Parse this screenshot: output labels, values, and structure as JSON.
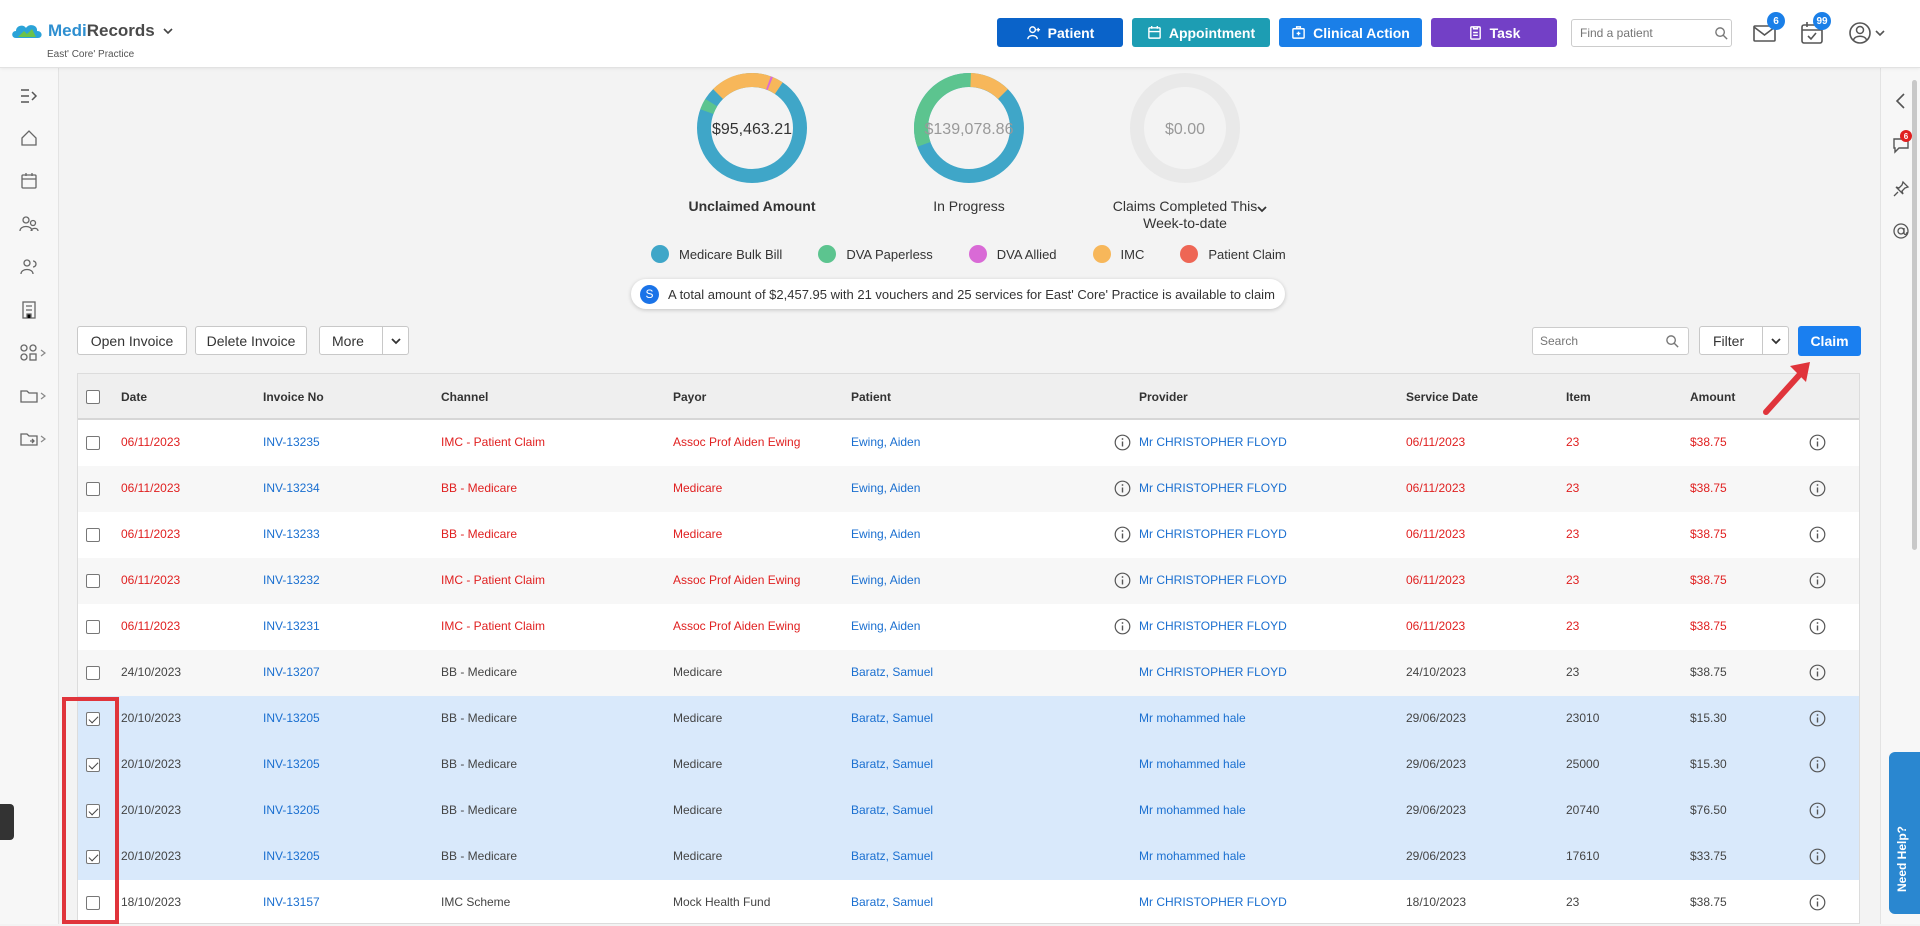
{
  "app": {
    "brand_part1": "Medi",
    "brand_part2": "Records",
    "practice": "East' Core' Practice"
  },
  "header": {
    "buttons": [
      {
        "label": "Patient",
        "color": "#0a63c9"
      },
      {
        "label": "Appointment",
        "color": "#1d9db3"
      },
      {
        "label": "Clinical Action",
        "color": "#1a7fe8"
      },
      {
        "label": "Task",
        "color": "#7340c6"
      }
    ],
    "find_placeholder": "Find a patient",
    "mail_count": "6",
    "tasks_count": "99"
  },
  "rightnav": {
    "chat_count": "6",
    "need_help": "Need Help?"
  },
  "summary": {
    "unclaimed": {
      "value": "$95,463.21",
      "label": "Unclaimed Amount"
    },
    "in_progress": {
      "value": "$139,078.86",
      "label": "In Progress"
    },
    "completed": {
      "value": "$0.00",
      "label_line1": "Claims Completed This",
      "label_line2": "Week-to-date"
    }
  },
  "legend": [
    {
      "label": "Medicare Bulk Bill",
      "color": "#3fa6c8"
    },
    {
      "label": "DVA Paperless",
      "color": "#5cc48f"
    },
    {
      "label": "DVA Allied",
      "color": "#d96ad6"
    },
    {
      "label": "IMC",
      "color": "#f7b75a"
    },
    {
      "label": "Patient Claim",
      "color": "#ee6655"
    }
  ],
  "info": {
    "icon_letter": "S",
    "message": "A total amount of $2,457.95 with 21 vouchers and 25 services for East' Core' Practice is available to claim"
  },
  "actions": {
    "open_invoice": "Open Invoice",
    "delete_invoice": "Delete Invoice",
    "more": "More",
    "search_placeholder": "Search",
    "filter": "Filter",
    "claim": "Claim"
  },
  "table": {
    "columns": [
      "Date",
      "Invoice No",
      "Channel",
      "Payor",
      "Patient",
      "Provider",
      "Service Date",
      "Item",
      "Amount"
    ],
    "rows": [
      {
        "date": "06/11/2023",
        "invoice": "INV-13235",
        "channel": "IMC - Patient Claim",
        "payor": "Assoc Prof Aiden Ewing",
        "patient": "Ewing, Aiden",
        "provider": "Mr CHRISTOPHER FLOYD",
        "service_date": "06/11/2023",
        "item": "23",
        "amount": "$38.75"
      },
      {
        "date": "06/11/2023",
        "invoice": "INV-13234",
        "channel": "BB - Medicare",
        "payor": "Medicare",
        "patient": "Ewing, Aiden",
        "provider": "Mr CHRISTOPHER FLOYD",
        "service_date": "06/11/2023",
        "item": "23",
        "amount": "$38.75"
      },
      {
        "date": "06/11/2023",
        "invoice": "INV-13233",
        "channel": "BB - Medicare",
        "payor": "Medicare",
        "patient": "Ewing, Aiden",
        "provider": "Mr CHRISTOPHER FLOYD",
        "service_date": "06/11/2023",
        "item": "23",
        "amount": "$38.75"
      },
      {
        "date": "06/11/2023",
        "invoice": "INV-13232",
        "channel": "IMC - Patient Claim",
        "payor": "Assoc Prof Aiden Ewing",
        "patient": "Ewing, Aiden",
        "provider": "Mr CHRISTOPHER FLOYD",
        "service_date": "06/11/2023",
        "item": "23",
        "amount": "$38.75"
      },
      {
        "date": "06/11/2023",
        "invoice": "INV-13231",
        "channel": "IMC - Patient Claim",
        "payor": "Assoc Prof Aiden Ewing",
        "patient": "Ewing, Aiden",
        "provider": "Mr CHRISTOPHER FLOYD",
        "service_date": "06/11/2023",
        "item": "23",
        "amount": "$38.75"
      },
      {
        "date": "24/10/2023",
        "invoice": "INV-13207",
        "channel": "BB - Medicare",
        "payor": "Medicare",
        "patient": "Baratz, Samuel",
        "provider": "Mr CHRISTOPHER FLOYD",
        "service_date": "24/10/2023",
        "item": "23",
        "amount": "$38.75"
      },
      {
        "date": "20/10/2023",
        "invoice": "INV-13205",
        "channel": "BB - Medicare",
        "payor": "Medicare",
        "patient": "Baratz, Samuel",
        "provider": "Mr mohammed hale",
        "service_date": "29/06/2023",
        "item": "23010",
        "amount": "$15.30"
      },
      {
        "date": "20/10/2023",
        "invoice": "INV-13205",
        "channel": "BB - Medicare",
        "payor": "Medicare",
        "patient": "Baratz, Samuel",
        "provider": "Mr mohammed hale",
        "service_date": "29/06/2023",
        "item": "25000",
        "amount": "$15.30"
      },
      {
        "date": "20/10/2023",
        "invoice": "INV-13205",
        "channel": "BB - Medicare",
        "payor": "Medicare",
        "patient": "Baratz, Samuel",
        "provider": "Mr mohammed hale",
        "service_date": "29/06/2023",
        "item": "20740",
        "amount": "$76.50"
      },
      {
        "date": "20/10/2023",
        "invoice": "INV-13205",
        "channel": "BB - Medicare",
        "payor": "Medicare",
        "patient": "Baratz, Samuel",
        "provider": "Mr mohammed hale",
        "service_date": "29/06/2023",
        "item": "17610",
        "amount": "$33.75"
      },
      {
        "date": "18/10/2023",
        "invoice": "INV-13157",
        "channel": "IMC Scheme",
        "payor": "Mock Health Fund",
        "patient": "Baratz, Samuel",
        "provider": "Mr CHRISTOPHER FLOYD",
        "service_date": "18/10/2023",
        "item": "23",
        "amount": "$38.75"
      }
    ]
  }
}
